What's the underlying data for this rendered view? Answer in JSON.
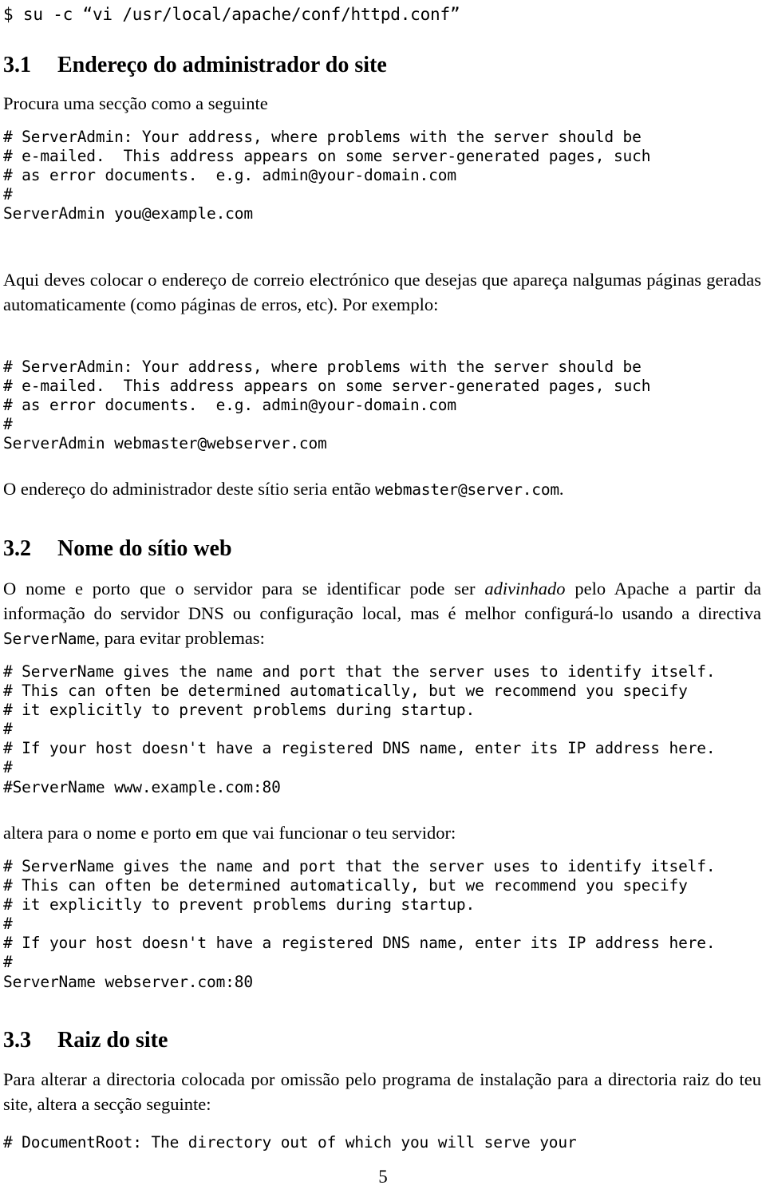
{
  "document": {
    "language": "pt-PT",
    "page_number": "5"
  },
  "command_line": "$ su -c “vi /usr/local/apache/conf/httpd.conf”",
  "sections": [
    {
      "number": "3.1",
      "title": "Endereço do administrador do site",
      "intro": "Procura uma secção como a seguinte",
      "code_block_1": "# ServerAdmin: Your address, where problems with the server should be\n# e-mailed.  This address appears on some server-generated pages, such\n# as error documents.  e.g. admin@your-domain.com\n#\nServerAdmin you@example.com",
      "paragraph": "Aqui deves colocar o endereço de correio electrónico que desejas que apareça nalgumas páginas geradas automaticamente (como páginas de erros, etc).  Por exemplo:",
      "code_block_2": "# ServerAdmin: Your address, where problems with the server should be\n# e-mailed.  This address appears on some server-generated pages, such\n# as error documents.  e.g. admin@your-domain.com\n#\nServerAdmin webmaster@webserver.com",
      "closing_prefix": "O endereço do administrador deste sítio seria então ",
      "closing_code": "webmaster@server.com",
      "closing_suffix": "."
    },
    {
      "number": "3.2",
      "title": "Nome do sítio web",
      "para_part1": "O nome e porto que o servidor para se identificar pode ser ",
      "para_italic": "adivinhado",
      "para_part2": " pelo Apache a partir da informação do servidor DNS ou configuração local, mas é melhor configurá-lo usando a directiva ",
      "para_code": "ServerName",
      "para_part3": ", para evitar problemas:",
      "code_block_1": "# ServerName gives the name and port that the server uses to identify itself.\n# This can often be determined automatically, but we recommend you specify\n# it explicitly to prevent problems during startup.\n#\n# If your host doesn't have a registered DNS name, enter its IP address here.\n#\n#ServerName www.example.com:80",
      "middle_text": "altera para o nome e porto em que vai funcionar o teu servidor:",
      "code_block_2": "# ServerName gives the name and port that the server uses to identify itself.\n# This can often be determined automatically, but we recommend you specify\n# it explicitly to prevent problems during startup.\n#\n# If your host doesn't have a registered DNS name, enter its IP address here.\n#\nServerName webserver.com:80"
    },
    {
      "number": "3.3",
      "title": "Raiz do site",
      "paragraph": "Para alterar a directoria colocada por omissão pelo programa de instalação para a directoria raiz do teu site, altera a secção seguinte:",
      "code_block_1": "# DocumentRoot: The directory out of which you will serve your"
    }
  ]
}
